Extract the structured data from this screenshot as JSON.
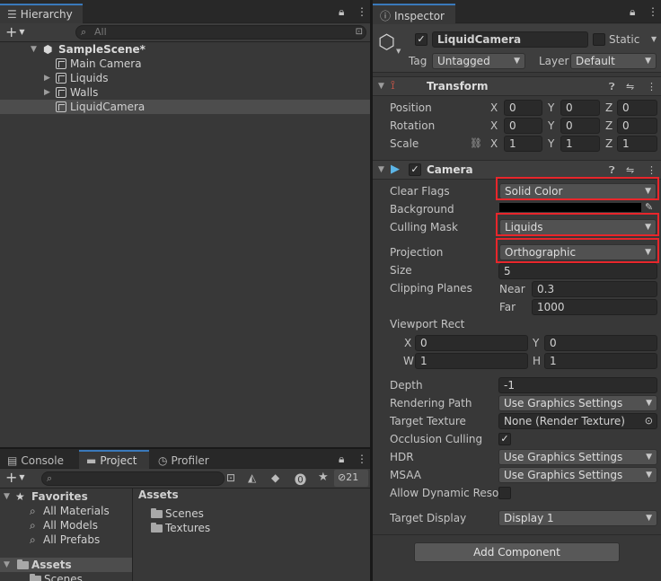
{
  "hierarchy": {
    "tab_label": "Hierarchy",
    "add_label": "+",
    "search_placeholder": "All",
    "scene": "SampleScene*",
    "items": [
      {
        "label": "Main Camera"
      },
      {
        "label": "Liquids"
      },
      {
        "label": "Walls"
      },
      {
        "label": "LiquidCamera"
      }
    ]
  },
  "project": {
    "tabs": [
      "Console",
      "Project",
      "Profiler"
    ],
    "hidden_count": "21",
    "favorites_label": "Favorites",
    "favorites": [
      "All Materials",
      "All Models",
      "All Prefabs"
    ],
    "assets_label": "Assets",
    "assets_tree_child": "Scenes",
    "breadcrumb": "Assets",
    "folders": [
      "Scenes",
      "Textures"
    ]
  },
  "inspector": {
    "tab_label": "Inspector",
    "object_name": "LiquidCamera",
    "static_label": "Static",
    "tag_label": "Tag",
    "tag_value": "Untagged",
    "layer_label": "Layer",
    "layer_value": "Default",
    "transform": {
      "title": "Transform",
      "position_label": "Position",
      "rotation_label": "Rotation",
      "scale_label": "Scale",
      "axis_x": "X",
      "axis_y": "Y",
      "axis_z": "Z",
      "position": [
        "0",
        "0",
        "0"
      ],
      "rotation": [
        "0",
        "0",
        "0"
      ],
      "scale": [
        "1",
        "1",
        "1"
      ]
    },
    "camera": {
      "title": "Camera",
      "clear_flags_label": "Clear Flags",
      "clear_flags": "Solid Color",
      "background_label": "Background",
      "background_color": "#000000",
      "culling_mask_label": "Culling Mask",
      "culling_mask": "Liquids",
      "projection_label": "Projection",
      "projection": "Orthographic",
      "size_label": "Size",
      "size": "5",
      "clipping_label": "Clipping Planes",
      "near_label": "Near",
      "near": "0.3",
      "far_label": "Far",
      "far": "1000",
      "viewport_label": "Viewport Rect",
      "vp_x_label": "X",
      "vp_x": "0",
      "vp_y_label": "Y",
      "vp_y": "0",
      "vp_w_label": "W",
      "vp_w": "1",
      "vp_h_label": "H",
      "vp_h": "1",
      "depth_label": "Depth",
      "depth": "-1",
      "rendering_path_label": "Rendering Path",
      "rendering_path": "Use Graphics Settings",
      "target_texture_label": "Target Texture",
      "target_texture": "None (Render Texture)",
      "occlusion_label": "Occlusion Culling",
      "hdr_label": "HDR",
      "hdr": "Use Graphics Settings",
      "msaa_label": "MSAA",
      "msaa": "Use Graphics Settings",
      "dynamic_res_label": "Allow Dynamic Resol",
      "target_display_label": "Target Display",
      "target_display": "Display 1"
    },
    "add_component": "Add Component"
  },
  "colors": {
    "highlight": "#e8262b",
    "tab_accent": "#3a79bb"
  }
}
